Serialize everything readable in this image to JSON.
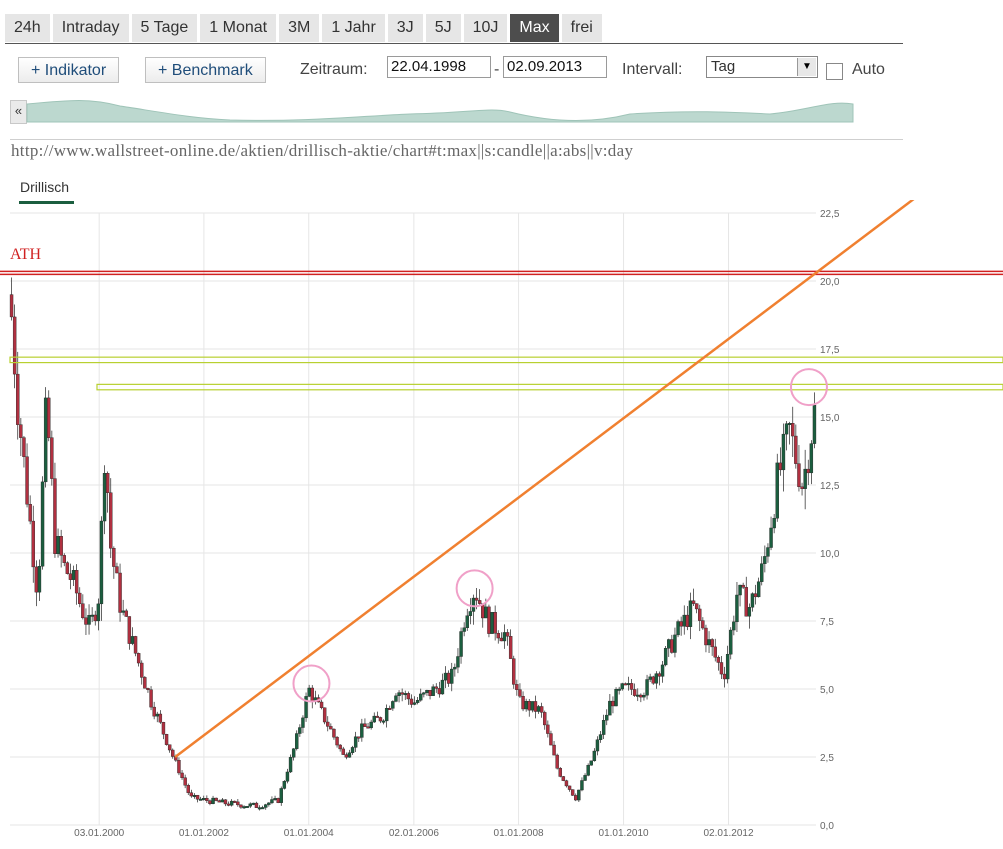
{
  "tabs": [
    {
      "label": "24h",
      "active": false
    },
    {
      "label": "Intraday",
      "active": false
    },
    {
      "label": "5 Tage",
      "active": false
    },
    {
      "label": "1 Monat",
      "active": false
    },
    {
      "label": "3M",
      "active": false
    },
    {
      "label": "1 Jahr",
      "active": false
    },
    {
      "label": "3J",
      "active": false
    },
    {
      "label": "5J",
      "active": false
    },
    {
      "label": "10J",
      "active": false
    },
    {
      "label": "Max",
      "active": true
    },
    {
      "label": "frei",
      "active": false
    }
  ],
  "toolbar": {
    "indicator_label": "+ Indikator",
    "benchmark_label": "+ Benchmark",
    "period_label": "Zeitraum:",
    "date_from": "22.04.1998",
    "date_separator": "-",
    "date_to": "02.09.2013",
    "interval_label": "Intervall:",
    "interval_value": "Tag",
    "auto_label": "Auto",
    "auto_checked": false
  },
  "navigator": {
    "collapse_glyph": "«"
  },
  "url_text": "http://www.wallstreet-online.de/aktien/drillisch-aktie/chart#t:max||s:candle||a:abs||v:day",
  "legend": {
    "series_name": "Drillisch",
    "color": "#1b5e3f"
  },
  "annotation": {
    "ath_label": "ATH",
    "ath_color": "#d02020",
    "trend_color": "#f08030",
    "zone_color": "#b8d030",
    "marker_color": "#f0a0c8"
  },
  "colors": {
    "up": "#1b5e3f",
    "down": "#b03040",
    "grid": "#e6e6e6"
  },
  "chart_data": {
    "type": "candlestick",
    "title": "",
    "series": [
      {
        "name": "Drillisch"
      }
    ],
    "x_range": [
      "1998-04-22",
      "2013-09-02"
    ],
    "x_ticks": [
      {
        "date": "2000-01-03",
        "label": "03.01.2000"
      },
      {
        "date": "2002-01-01",
        "label": "01.01.2002"
      },
      {
        "date": "2004-01-01",
        "label": "01.01.2004"
      },
      {
        "date": "2006-01-02",
        "label": "02.01.2006"
      },
      {
        "date": "2008-01-01",
        "label": "01.01.2008"
      },
      {
        "date": "2010-01-01",
        "label": "01.01.2010"
      },
      {
        "date": "2012-01-02",
        "label": "02.01.2012"
      }
    ],
    "ylim": [
      0,
      22.5
    ],
    "y_ticks": [
      0,
      2.5,
      5,
      7.5,
      10,
      12.5,
      15,
      17.5,
      20,
      22.5
    ],
    "y_tick_labels": [
      "0,0",
      "2,5",
      "5,0",
      "7,5",
      "10,0",
      "12,5",
      "15,0",
      "17,5",
      "20,0",
      "22,5"
    ],
    "grid": true,
    "close_points": [
      {
        "date": "1998-04-22",
        "close": 19.5
      },
      {
        "date": "1998-06-15",
        "close": 15.5
      },
      {
        "date": "1998-09-01",
        "close": 11.5
      },
      {
        "date": "1998-11-01",
        "close": 8.5
      },
      {
        "date": "1999-01-01",
        "close": 15.5
      },
      {
        "date": "1999-03-01",
        "close": 10.5
      },
      {
        "date": "1999-05-01",
        "close": 9.5
      },
      {
        "date": "1999-07-01",
        "close": 9.0
      },
      {
        "date": "1999-09-01",
        "close": 8.0
      },
      {
        "date": "1999-11-01",
        "close": 7.2
      },
      {
        "date": "2000-01-01",
        "close": 8.5
      },
      {
        "date": "2000-02-15",
        "close": 14.5
      },
      {
        "date": "2000-03-15",
        "close": 10.5
      },
      {
        "date": "2000-06-01",
        "close": 8.0
      },
      {
        "date": "2000-09-01",
        "close": 6.5
      },
      {
        "date": "2001-01-01",
        "close": 4.5
      },
      {
        "date": "2001-06-01",
        "close": 2.5
      },
      {
        "date": "2001-10-01",
        "close": 1.0
      },
      {
        "date": "2002-06-01",
        "close": 0.8
      },
      {
        "date": "2003-01-01",
        "close": 0.7
      },
      {
        "date": "2003-06-01",
        "close": 0.9
      },
      {
        "date": "2003-10-01",
        "close": 3.0
      },
      {
        "date": "2004-01-01",
        "close": 5.0
      },
      {
        "date": "2004-06-01",
        "close": 3.5
      },
      {
        "date": "2004-09-01",
        "close": 2.5
      },
      {
        "date": "2005-01-01",
        "close": 3.5
      },
      {
        "date": "2005-06-01",
        "close": 4.0
      },
      {
        "date": "2005-09-01",
        "close": 5.0
      },
      {
        "date": "2006-01-01",
        "close": 4.5
      },
      {
        "date": "2006-06-01",
        "close": 5.0
      },
      {
        "date": "2006-10-01",
        "close": 5.5
      },
      {
        "date": "2007-01-01",
        "close": 8.0
      },
      {
        "date": "2007-03-01",
        "close": 8.7
      },
      {
        "date": "2007-06-01",
        "close": 7.5
      },
      {
        "date": "2007-10-01",
        "close": 7.0
      },
      {
        "date": "2008-01-01",
        "close": 4.5
      },
      {
        "date": "2008-06-01",
        "close": 4.2
      },
      {
        "date": "2008-10-01",
        "close": 2.0
      },
      {
        "date": "2009-02-01",
        "close": 1.0
      },
      {
        "date": "2009-06-01",
        "close": 2.5
      },
      {
        "date": "2009-10-01",
        "close": 4.5
      },
      {
        "date": "2010-01-01",
        "close": 5.0
      },
      {
        "date": "2010-06-01",
        "close": 5.0
      },
      {
        "date": "2010-10-01",
        "close": 6.0
      },
      {
        "date": "2011-01-01",
        "close": 7.0
      },
      {
        "date": "2011-05-01",
        "close": 8.0
      },
      {
        "date": "2011-09-01",
        "close": 6.5
      },
      {
        "date": "2011-12-01",
        "close": 5.5
      },
      {
        "date": "2012-03-01",
        "close": 8.5
      },
      {
        "date": "2012-06-01",
        "close": 8.0
      },
      {
        "date": "2012-09-01",
        "close": 9.5
      },
      {
        "date": "2012-12-01",
        "close": 12.5
      },
      {
        "date": "2013-03-01",
        "close": 14.5
      },
      {
        "date": "2013-06-01",
        "close": 12.5
      },
      {
        "date": "2013-09-02",
        "close": 15.5
      }
    ],
    "annotations": {
      "ath_level": 20.3,
      "resistance_zone_1": [
        17.0,
        17.2
      ],
      "resistance_zone_2": [
        16.0,
        16.2
      ],
      "trendline": [
        {
          "date": "2001-06-15",
          "value": 2.5
        },
        {
          "date": "2013-09-02",
          "value": 20.3
        }
      ],
      "circled_peaks": [
        {
          "date": "2004-01-20",
          "value": 5.2
        },
        {
          "date": "2007-03-01",
          "value": 8.7
        },
        {
          "date": "2013-07-15",
          "value": 16.1
        }
      ]
    }
  }
}
